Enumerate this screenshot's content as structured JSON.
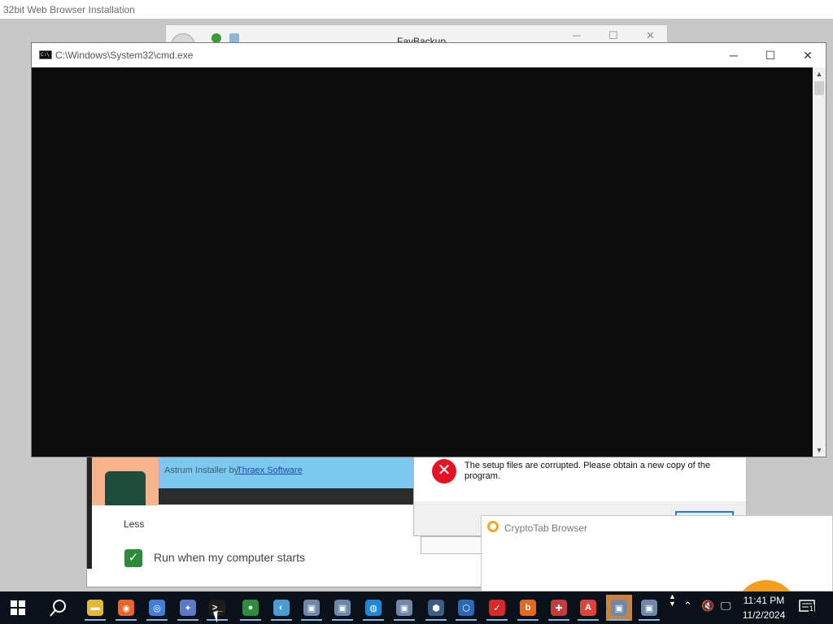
{
  "background_window": {
    "title": "32bit Web Browser Installation"
  },
  "favbackup": {
    "title": "FavBackup"
  },
  "cmd": {
    "title": "C:\\Windows\\System32\\cmd.exe",
    "icon_text": "C:\\",
    "minimize": "─",
    "maximize": "☐",
    "close": "✕"
  },
  "astrum": {
    "installer_by": "Astrum Installer by",
    "vendor_link": "Thraex Software",
    "less": "Less",
    "checkbox_label": "Run when my computer starts",
    "checkbox_checked": true
  },
  "error_dialog": {
    "icon": "✕",
    "message": "The setup files are corrupted. Please obtain a new copy of the program."
  },
  "cryptotab": {
    "title": "CryptoTab Browser"
  },
  "taskbar": {
    "time": "11:41 PM",
    "date": "11/2/2024",
    "notification_count": "1",
    "apps": [
      {
        "name": "file-explorer",
        "color": "#e7b73b",
        "glyph": "▬"
      },
      {
        "name": "firefox",
        "color": "#e8662a",
        "glyph": "◉"
      },
      {
        "name": "chrome",
        "color": "#3f7fd6",
        "glyph": "◎"
      },
      {
        "name": "bird-app",
        "color": "#5c78c8",
        "glyph": "✦"
      },
      {
        "name": "cmd",
        "color": "#1d1d1d",
        "glyph": ">_"
      },
      {
        "name": "globe-app",
        "color": "#2d8d3c",
        "glyph": "●"
      },
      {
        "name": "swirl-app",
        "color": "#4a9bd4",
        "glyph": "◐"
      },
      {
        "name": "installer-1",
        "color": "#6d88a8",
        "glyph": "▣"
      },
      {
        "name": "installer-2",
        "color": "#6d88a8",
        "glyph": "▣"
      },
      {
        "name": "edge-globe",
        "color": "#1e88d8",
        "glyph": "◍"
      },
      {
        "name": "installer-3",
        "color": "#6d88a8",
        "glyph": "▣"
      },
      {
        "name": "shield-app",
        "color": "#3a5d84",
        "glyph": "⬢"
      },
      {
        "name": "hex-app",
        "color": "#2968b3",
        "glyph": "⬡"
      },
      {
        "name": "avira",
        "color": "#d62b2b",
        "glyph": "✓"
      },
      {
        "name": "b-app",
        "color": "#e06a1e",
        "glyph": "b"
      },
      {
        "name": "gift-app",
        "color": "#c43b3b",
        "glyph": "✚"
      },
      {
        "name": "a-app",
        "color": "#d9453a",
        "glyph": "A"
      },
      {
        "name": "installer-active",
        "color": "#6d88a8",
        "glyph": "▣"
      },
      {
        "name": "installer-4",
        "color": "#6d88a8",
        "glyph": "▣"
      }
    ]
  }
}
